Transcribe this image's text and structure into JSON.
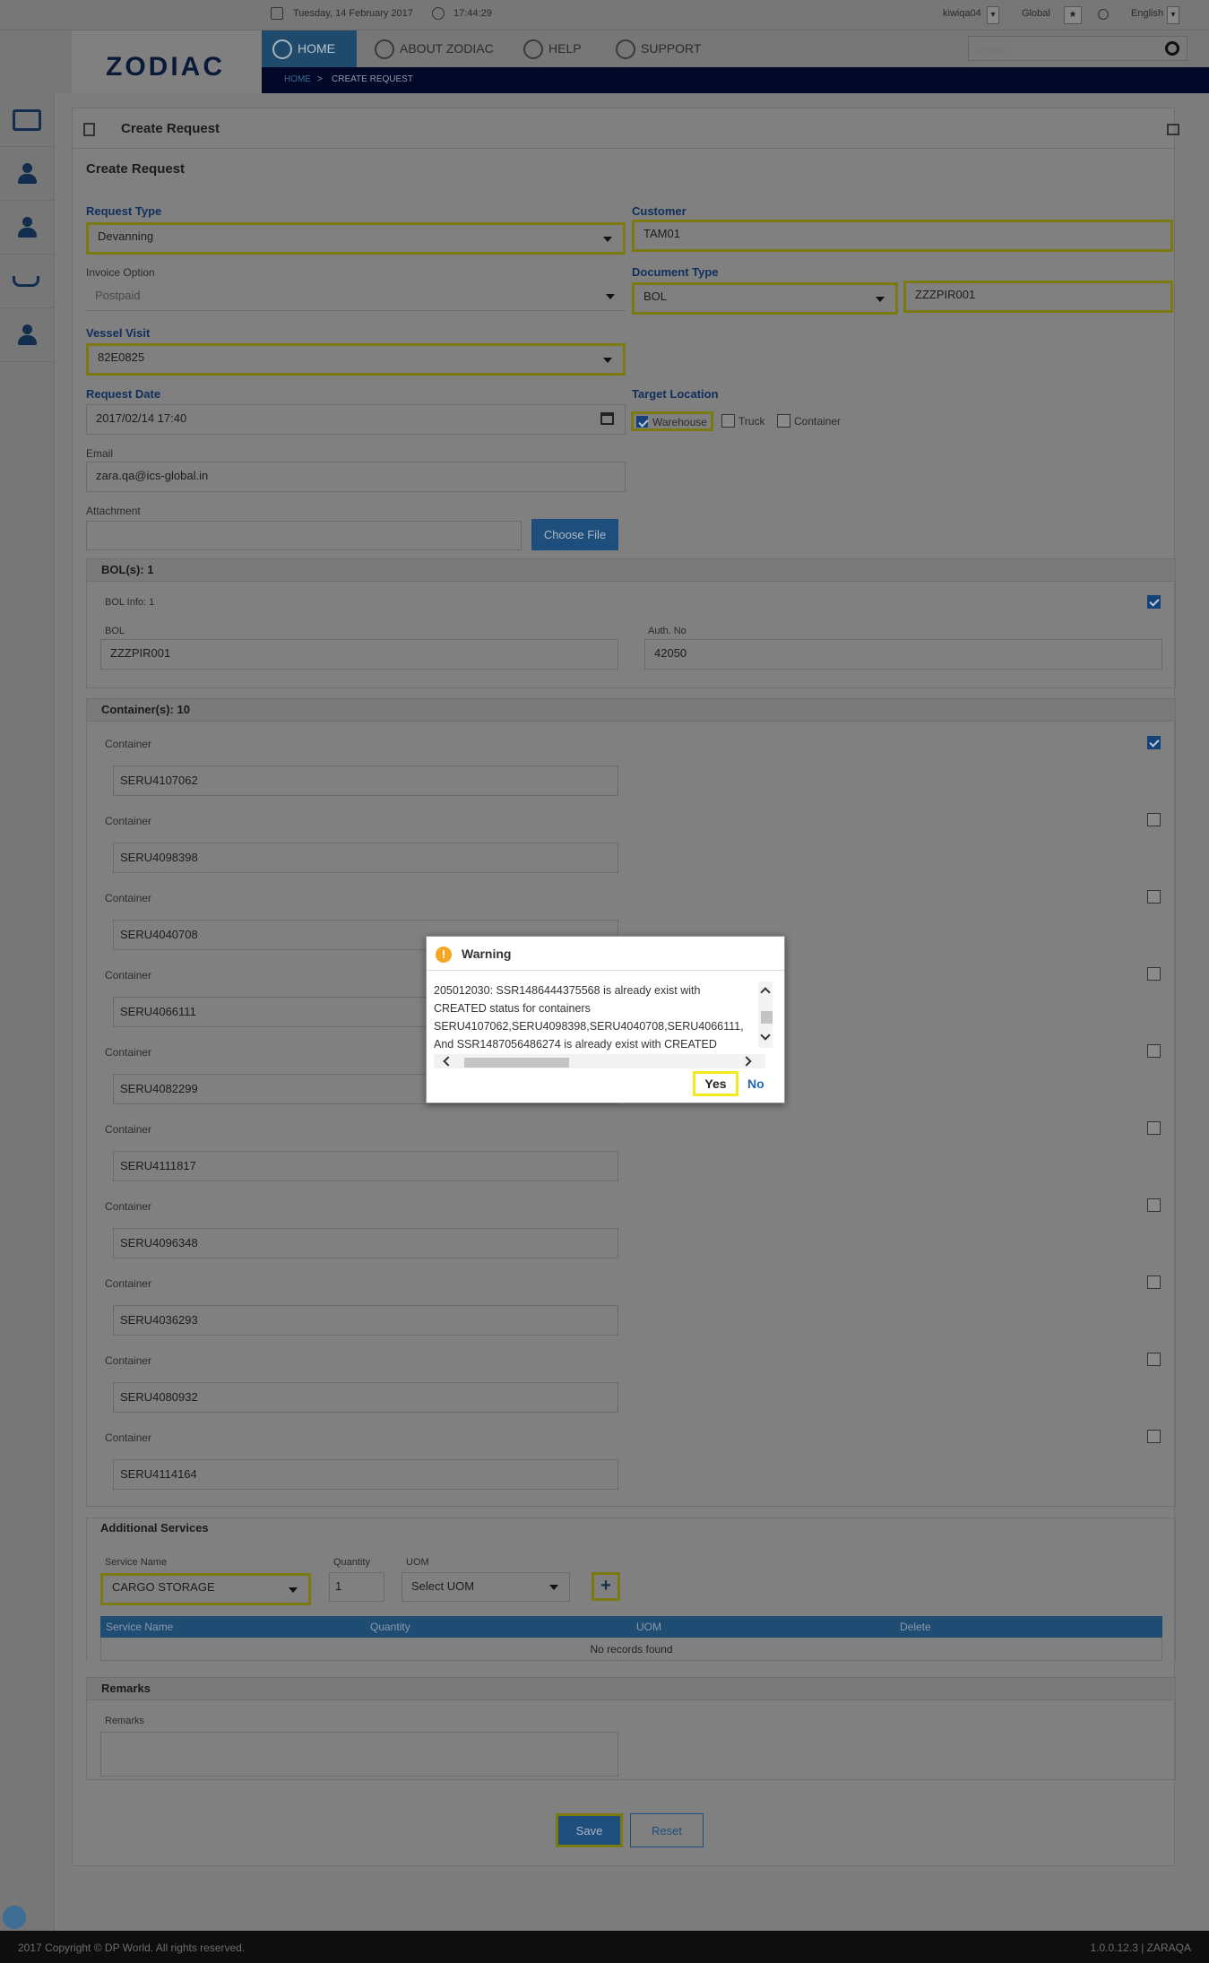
{
  "topbar": {
    "date": "Tuesday, 14 February 2017",
    "time": "17:44:29",
    "user": "kiwiqa04",
    "region": "Global",
    "language": "English"
  },
  "header": {
    "logo_text": "ZODIAC",
    "nav": [
      {
        "label": "HOME",
        "icon": "home-icon",
        "active": true
      },
      {
        "label": "ABOUT ZODIAC",
        "icon": "people-icon",
        "active": false
      },
      {
        "label": "HELP",
        "icon": "question-icon",
        "active": false
      },
      {
        "label": "SUPPORT",
        "icon": "support-icon",
        "active": false
      }
    ],
    "breadcrumb": {
      "home": "HOME",
      "sep": ">",
      "current": "CREATE REQUEST"
    },
    "search_placeholder": "Search"
  },
  "sidebar": {
    "items": [
      {
        "icon": "inbox-icon"
      },
      {
        "icon": "user-icon"
      },
      {
        "icon": "user-icon"
      },
      {
        "icon": "ship-icon"
      },
      {
        "icon": "user-icon"
      }
    ]
  },
  "panel": {
    "title": "Create Request",
    "section_title": "Create Request"
  },
  "form": {
    "request_type": {
      "label": "Request Type",
      "value": "Devanning"
    },
    "customer": {
      "label": "Customer",
      "value": "TAM01"
    },
    "invoice_option": {
      "label": "Invoice Option",
      "value": "Postpaid"
    },
    "document_type": {
      "label": "Document Type",
      "value": "BOL",
      "number": "ZZZPIR001"
    },
    "vessel_visit": {
      "label": "Vessel Visit",
      "value": "82E0825"
    },
    "request_date": {
      "label": "Request Date",
      "value": "2017/02/14 17:40"
    },
    "target_location": {
      "label": "Target Location",
      "options": [
        {
          "label": "Warehouse",
          "checked": true
        },
        {
          "label": "Truck",
          "checked": false
        },
        {
          "label": "Container",
          "checked": false
        }
      ]
    },
    "email": {
      "label": "Email",
      "value": "zara.qa@ics-global.in"
    },
    "attachment": {
      "label": "Attachment",
      "value": "",
      "button": "Choose File"
    }
  },
  "bols": {
    "header": "BOL(s): 1",
    "info": "BOL Info: 1",
    "checked": true,
    "bol_label": "BOL",
    "bol_value": "ZZZPIR001",
    "auth_label": "Auth. No",
    "auth_value": "42050"
  },
  "containers": {
    "header": "Container(s): 10",
    "label": "Container",
    "items": [
      {
        "value": "SERU4107062",
        "checked": true
      },
      {
        "value": "SERU4098398",
        "checked": false
      },
      {
        "value": "SERU4040708",
        "checked": false
      },
      {
        "value": "SERU4066111",
        "checked": false
      },
      {
        "value": "SERU4082299",
        "checked": false
      },
      {
        "value": "SERU4111817",
        "checked": false
      },
      {
        "value": "SERU4096348",
        "checked": false
      },
      {
        "value": "SERU4036293",
        "checked": false
      },
      {
        "value": "SERU4080932",
        "checked": false
      },
      {
        "value": "SERU4114164",
        "checked": false
      }
    ]
  },
  "additional_services": {
    "header": "Additional Services",
    "service_name_label": "Service Name",
    "service_name_value": "CARGO STORAGE",
    "quantity_label": "Quantity",
    "quantity_value": "1",
    "uom_label": "UOM",
    "uom_value": "Select UOM",
    "add_label": "+",
    "table_columns": [
      "Service Name",
      "Quantity",
      "UOM",
      "Delete"
    ],
    "empty_text": "No records found"
  },
  "remarks": {
    "header": "Remarks",
    "label": "Remarks",
    "value": ""
  },
  "actions": {
    "save": "Save",
    "reset": "Reset"
  },
  "footer": {
    "copyright": "2017 Copyright © DP World. All rights reserved.",
    "version": "1.0.0.12.3 | ZARAQA"
  },
  "modal": {
    "title": "Warning",
    "icon": "warning-icon",
    "message_lines": [
      "205012030: SSR1486444375568 is already exist with",
      "CREATED status for containers",
      "SERU4107062,SERU4098398,SERU4040708,SERU4066111,",
      "And SSR1487056486274 is already exist with CREATED"
    ],
    "yes": "Yes",
    "no": "No"
  }
}
